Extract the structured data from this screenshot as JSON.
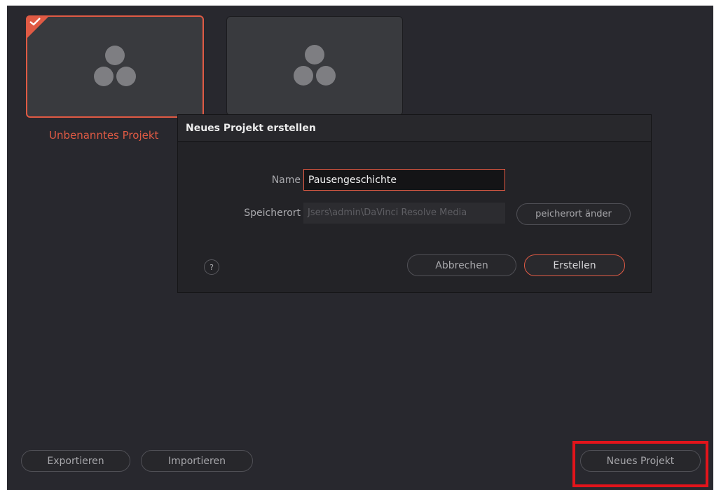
{
  "projects": [
    {
      "name": "Unbenanntes Projekt",
      "selected": true
    },
    {
      "name": "",
      "selected": false
    }
  ],
  "dialog": {
    "title": "Neues Projekt erstellen",
    "name_label": "Name",
    "name_value": "Pausengeschichte",
    "location_label": "Speicherort",
    "location_value": "Jsers\\admin\\DaVinci Resolve Media",
    "change_location_label": "peicherort änder",
    "help_label": "?",
    "cancel_label": "Abbrechen",
    "create_label": "Erstellen"
  },
  "footer": {
    "export_label": "Exportieren",
    "import_label": "Importieren",
    "new_project_label": "Neues Projekt"
  },
  "icons": {
    "tile_logo": "resolve-logo-icon",
    "selected_mark": "checkmark-icon"
  },
  "colors": {
    "accent": "#e05a44",
    "background": "#28282e",
    "highlight": "#e2141b"
  }
}
